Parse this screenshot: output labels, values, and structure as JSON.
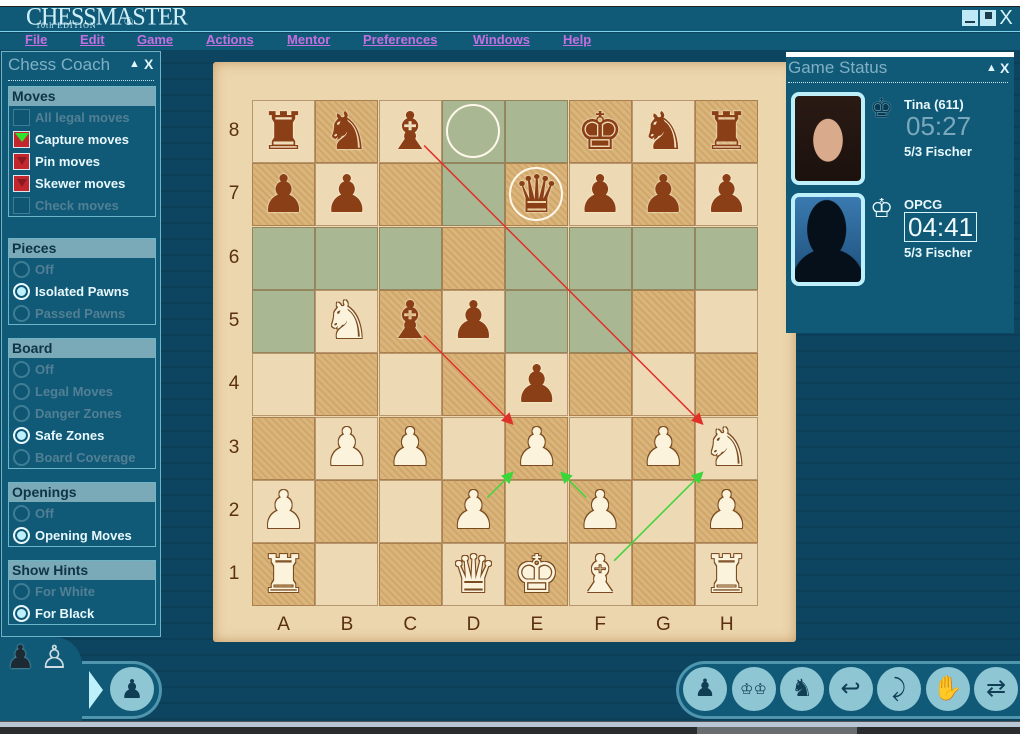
{
  "app": {
    "logo_main": "CHESSMASTER",
    "logo_sub": "10th EDITION",
    "logo_reg": "®",
    "window_controls": {
      "minimize": "minimize",
      "maximize": "maximize",
      "close": "X"
    }
  },
  "menu": [
    {
      "label": "File"
    },
    {
      "label": "Edit"
    },
    {
      "label": "Game"
    },
    {
      "label": "Actions"
    },
    {
      "label": "Mentor"
    },
    {
      "label": "Preferences"
    },
    {
      "label": "Windows"
    },
    {
      "label": "Help"
    }
  ],
  "coach": {
    "title": "Chess Coach",
    "collapse": "▲",
    "close": "X",
    "sections": [
      {
        "heading": "Moves",
        "type": "checkbox",
        "options": [
          {
            "label": "All legal moves",
            "state": "off"
          },
          {
            "label": "Capture moves",
            "state": "green"
          },
          {
            "label": "Pin moves",
            "state": "red"
          },
          {
            "label": "Skewer moves",
            "state": "red"
          },
          {
            "label": "Check moves",
            "state": "off"
          }
        ]
      },
      {
        "heading": "Pieces",
        "type": "radio",
        "options": [
          {
            "label": "Off",
            "state": "off"
          },
          {
            "label": "Isolated Pawns",
            "state": "on"
          },
          {
            "label": "Passed Pawns",
            "state": "off"
          }
        ]
      },
      {
        "heading": "Board",
        "type": "radio",
        "options": [
          {
            "label": "Off",
            "state": "off"
          },
          {
            "label": "Legal Moves",
            "state": "off"
          },
          {
            "label": "Danger Zones",
            "state": "off"
          },
          {
            "label": "Safe Zones",
            "state": "on"
          },
          {
            "label": "Board Coverage",
            "state": "off"
          }
        ]
      },
      {
        "heading": "Openings",
        "type": "radio",
        "options": [
          {
            "label": "Off",
            "state": "off"
          },
          {
            "label": "Opening Moves",
            "state": "on"
          }
        ]
      },
      {
        "heading": "Show Hints",
        "type": "radio",
        "options": [
          {
            "label": "For White",
            "state": "off"
          },
          {
            "label": "For Black",
            "state": "on"
          }
        ]
      }
    ]
  },
  "board": {
    "files": [
      "A",
      "B",
      "C",
      "D",
      "E",
      "F",
      "G",
      "H"
    ],
    "ranks": [
      "8",
      "7",
      "6",
      "5",
      "4",
      "3",
      "2",
      "1"
    ],
    "pieces": [
      {
        "square": "a8",
        "color": "black",
        "type": "rook",
        "glyph": "♜"
      },
      {
        "square": "b8",
        "color": "black",
        "type": "knight",
        "glyph": "♞"
      },
      {
        "square": "c8",
        "color": "black",
        "type": "bishop",
        "glyph": "♝"
      },
      {
        "square": "f8",
        "color": "black",
        "type": "king",
        "glyph": "♚"
      },
      {
        "square": "g8",
        "color": "black",
        "type": "knight",
        "glyph": "♞"
      },
      {
        "square": "h8",
        "color": "black",
        "type": "rook",
        "glyph": "♜"
      },
      {
        "square": "a7",
        "color": "black",
        "type": "pawn",
        "glyph": "♟"
      },
      {
        "square": "b7",
        "color": "black",
        "type": "pawn",
        "glyph": "♟"
      },
      {
        "square": "e7",
        "color": "black",
        "type": "queen",
        "glyph": "♛"
      },
      {
        "square": "f7",
        "color": "black",
        "type": "pawn",
        "glyph": "♟"
      },
      {
        "square": "g7",
        "color": "black",
        "type": "pawn",
        "glyph": "♟"
      },
      {
        "square": "h7",
        "color": "black",
        "type": "pawn",
        "glyph": "♟"
      },
      {
        "square": "b5",
        "color": "white",
        "type": "knight",
        "glyph": "♞"
      },
      {
        "square": "c5",
        "color": "black",
        "type": "bishop",
        "glyph": "♝"
      },
      {
        "square": "d5",
        "color": "black",
        "type": "pawn",
        "glyph": "♟"
      },
      {
        "square": "e4",
        "color": "black",
        "type": "pawn",
        "glyph": "♟"
      },
      {
        "square": "b3",
        "color": "white",
        "type": "pawn",
        "glyph": "♟"
      },
      {
        "square": "c3",
        "color": "white",
        "type": "pawn",
        "glyph": "♟"
      },
      {
        "square": "e3",
        "color": "white",
        "type": "pawn",
        "glyph": "♟"
      },
      {
        "square": "g3",
        "color": "white",
        "type": "pawn",
        "glyph": "♟"
      },
      {
        "square": "h3",
        "color": "white",
        "type": "knight",
        "glyph": "♞"
      },
      {
        "square": "a2",
        "color": "white",
        "type": "pawn",
        "glyph": "♟"
      },
      {
        "square": "d2",
        "color": "white",
        "type": "pawn",
        "glyph": "♟"
      },
      {
        "square": "f2",
        "color": "white",
        "type": "pawn",
        "glyph": "♟"
      },
      {
        "square": "h2",
        "color": "white",
        "type": "pawn",
        "glyph": "♟"
      },
      {
        "square": "a1",
        "color": "white",
        "type": "rook",
        "glyph": "♜"
      },
      {
        "square": "d1",
        "color": "white",
        "type": "queen",
        "glyph": "♛"
      },
      {
        "square": "e1",
        "color": "white",
        "type": "king",
        "glyph": "♚"
      },
      {
        "square": "f1",
        "color": "white",
        "type": "bishop",
        "glyph": "♝"
      },
      {
        "square": "h1",
        "color": "white",
        "type": "rook",
        "glyph": "♜"
      }
    ],
    "safe_zone_squares": [
      "d8",
      "e8",
      "d7",
      "a6",
      "b6",
      "c6",
      "e6",
      "f6",
      "g6",
      "h6",
      "a5",
      "e5",
      "f5"
    ],
    "ringed_squares": [
      "d8",
      "e7"
    ],
    "arrows": [
      {
        "from": "c8",
        "to": "h3",
        "color": "#e0302a"
      },
      {
        "from": "c5",
        "to": "e3",
        "color": "#e0302a"
      },
      {
        "from": "d2",
        "to": "e3",
        "color": "#3ad63a"
      },
      {
        "from": "f2",
        "to": "e3",
        "color": "#3ad63a"
      },
      {
        "from": "f1",
        "to": "h3",
        "color": "#3ad63a"
      }
    ]
  },
  "game_status": {
    "title": "Game Status",
    "collapse": "▲",
    "close": "X",
    "players": [
      {
        "name": "Tina (611)",
        "clock": "05:27",
        "time_control": "5/3 Fischer",
        "side": "black",
        "king_glyph": "♚",
        "active": false
      },
      {
        "name": "OPCG",
        "clock": "04:41",
        "time_control": "5/3 Fischer",
        "side": "white",
        "king_glyph": "♔",
        "active": true
      }
    ]
  },
  "bottom": {
    "pawn_pair": [
      "♟",
      "♙"
    ],
    "expand_toggle": "▶",
    "left_button_glyph": "♟",
    "toolbar": [
      {
        "name": "move-now",
        "glyph": "♟"
      },
      {
        "name": "flip-board",
        "glyph": "♔♔"
      },
      {
        "name": "new-game",
        "glyph": "♞"
      },
      {
        "name": "take-back",
        "glyph": "↩"
      },
      {
        "name": "take-back-all",
        "glyph": "⤸"
      },
      {
        "name": "stop",
        "glyph": "✋"
      },
      {
        "name": "swap-sides",
        "glyph": "⇄"
      }
    ]
  },
  "colors": {
    "panel_bg": "#105a78",
    "menu_text": "#c56fe0",
    "safe_zone": "#a9b893",
    "board_light": "#edd9b3",
    "board_dark": "#d9b57c"
  }
}
